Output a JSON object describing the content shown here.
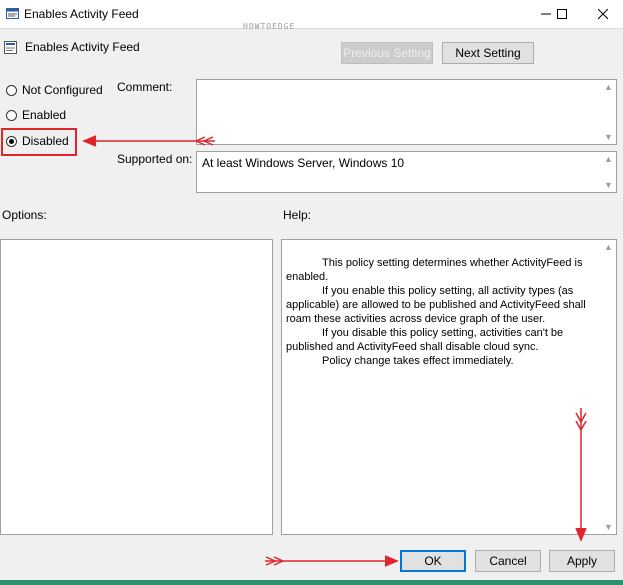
{
  "window": {
    "title": "Enables Activity Feed",
    "watermark": "HOWTOEDGE"
  },
  "header": {
    "policy_title": "Enables Activity Feed",
    "previous_setting": "Previous Setting",
    "next_setting": "Next Setting"
  },
  "state": {
    "options": [
      {
        "label": "Not Configured",
        "checked": false
      },
      {
        "label": "Enabled",
        "checked": false
      },
      {
        "label": "Disabled",
        "checked": true
      }
    ]
  },
  "comment": {
    "label": "Comment:",
    "value": ""
  },
  "supported": {
    "label": "Supported on:",
    "value": "At least Windows Server, Windows 10"
  },
  "panels": {
    "options_label": "Options:",
    "help_label": "Help:",
    "help_paragraphs": [
      "This policy setting determines whether ActivityFeed is enabled.",
      "If you enable this policy setting, all activity types (as applicable) are allowed to be published and ActivityFeed shall roam these activities across device graph of the user.",
      "If you disable this policy setting, activities can't be published and ActivityFeed shall disable cloud sync.",
      "Policy change takes effect immediately."
    ]
  },
  "footer": {
    "ok": "OK",
    "cancel": "Cancel",
    "apply": "Apply"
  },
  "colors": {
    "annotation_red": "#e0262b",
    "accent_blue": "#0078d7"
  },
  "icons": {
    "window_icon": "policy-icon",
    "minimize": "minimize-icon",
    "maximize": "maximize-icon",
    "close": "close-icon"
  }
}
